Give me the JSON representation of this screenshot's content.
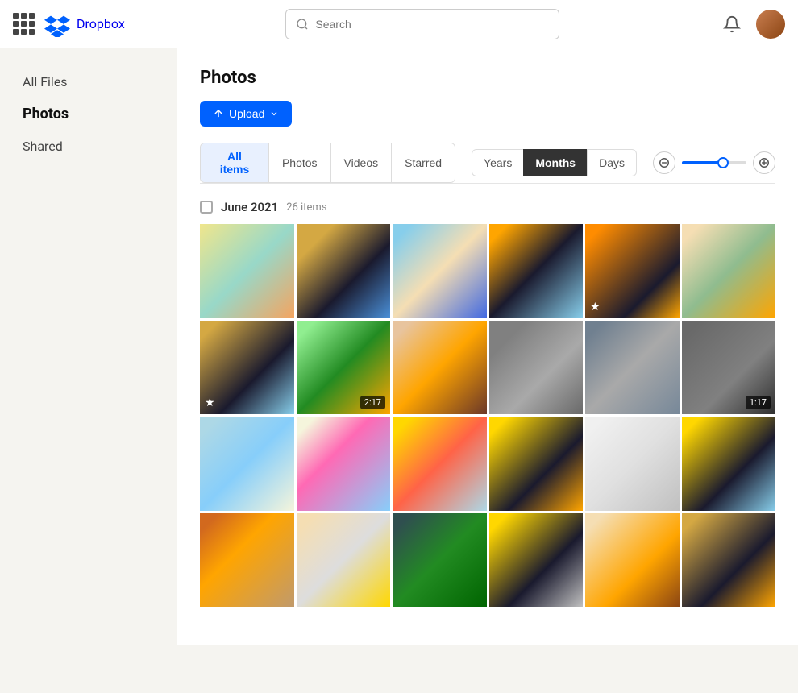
{
  "topbar": {
    "logo_text": "Dropbox",
    "search_placeholder": "Search",
    "grid_icon_label": "Apps menu"
  },
  "sidebar": {
    "items": [
      {
        "id": "all-files",
        "label": "All Files",
        "active": false
      },
      {
        "id": "photos",
        "label": "Photos",
        "active": true
      },
      {
        "id": "shared",
        "label": "Shared",
        "active": false
      }
    ]
  },
  "main": {
    "page_title": "Photos",
    "upload_button": "Upload",
    "filter_tabs": [
      {
        "id": "all-items",
        "label": "All items",
        "active": true
      },
      {
        "id": "photos",
        "label": "Photos",
        "active": false
      },
      {
        "id": "videos",
        "label": "Videos",
        "active": false
      },
      {
        "id": "starred",
        "label": "Starred",
        "active": false
      }
    ],
    "time_tabs": [
      {
        "id": "years",
        "label": "Years",
        "active": false
      },
      {
        "id": "months",
        "label": "Months",
        "active": true
      },
      {
        "id": "days",
        "label": "Days",
        "active": false
      }
    ],
    "section": {
      "title": "June 2021",
      "count": "26 items"
    },
    "photos": [
      {
        "id": 1,
        "class": "p1",
        "badge": null,
        "star": false
      },
      {
        "id": 2,
        "class": "p2",
        "badge": null,
        "star": false
      },
      {
        "id": 3,
        "class": "p3",
        "badge": null,
        "star": false
      },
      {
        "id": 4,
        "class": "p4",
        "badge": null,
        "star": false
      },
      {
        "id": 5,
        "class": "p5",
        "badge": null,
        "star": true
      },
      {
        "id": 6,
        "class": "p6",
        "badge": null,
        "star": false
      },
      {
        "id": 7,
        "class": "p7",
        "badge": null,
        "star": true
      },
      {
        "id": 8,
        "class": "p8",
        "badge": "2:17",
        "star": false
      },
      {
        "id": 9,
        "class": "p9",
        "badge": null,
        "star": false
      },
      {
        "id": 10,
        "class": "p10",
        "badge": null,
        "star": false
      },
      {
        "id": 11,
        "class": "p11",
        "badge": null,
        "star": false
      },
      {
        "id": 12,
        "class": "p12",
        "badge": "1:17",
        "star": false
      },
      {
        "id": 13,
        "class": "p13",
        "badge": null,
        "star": false
      },
      {
        "id": 14,
        "class": "p14",
        "badge": null,
        "star": false
      },
      {
        "id": 15,
        "class": "p15",
        "badge": null,
        "star": false
      },
      {
        "id": 16,
        "class": "p16",
        "badge": null,
        "star": false
      },
      {
        "id": 17,
        "class": "p17",
        "badge": null,
        "star": false
      },
      {
        "id": 18,
        "class": "p18",
        "badge": null,
        "star": false
      },
      {
        "id": 19,
        "class": "p19",
        "badge": null,
        "star": false
      },
      {
        "id": 20,
        "class": "p20",
        "badge": null,
        "star": false
      },
      {
        "id": 21,
        "class": "p21",
        "badge": null,
        "star": false
      },
      {
        "id": 22,
        "class": "p22",
        "badge": null,
        "star": false
      },
      {
        "id": 23,
        "class": "p23",
        "badge": null,
        "star": false
      },
      {
        "id": 24,
        "class": "p24",
        "badge": null,
        "star": false
      }
    ]
  }
}
